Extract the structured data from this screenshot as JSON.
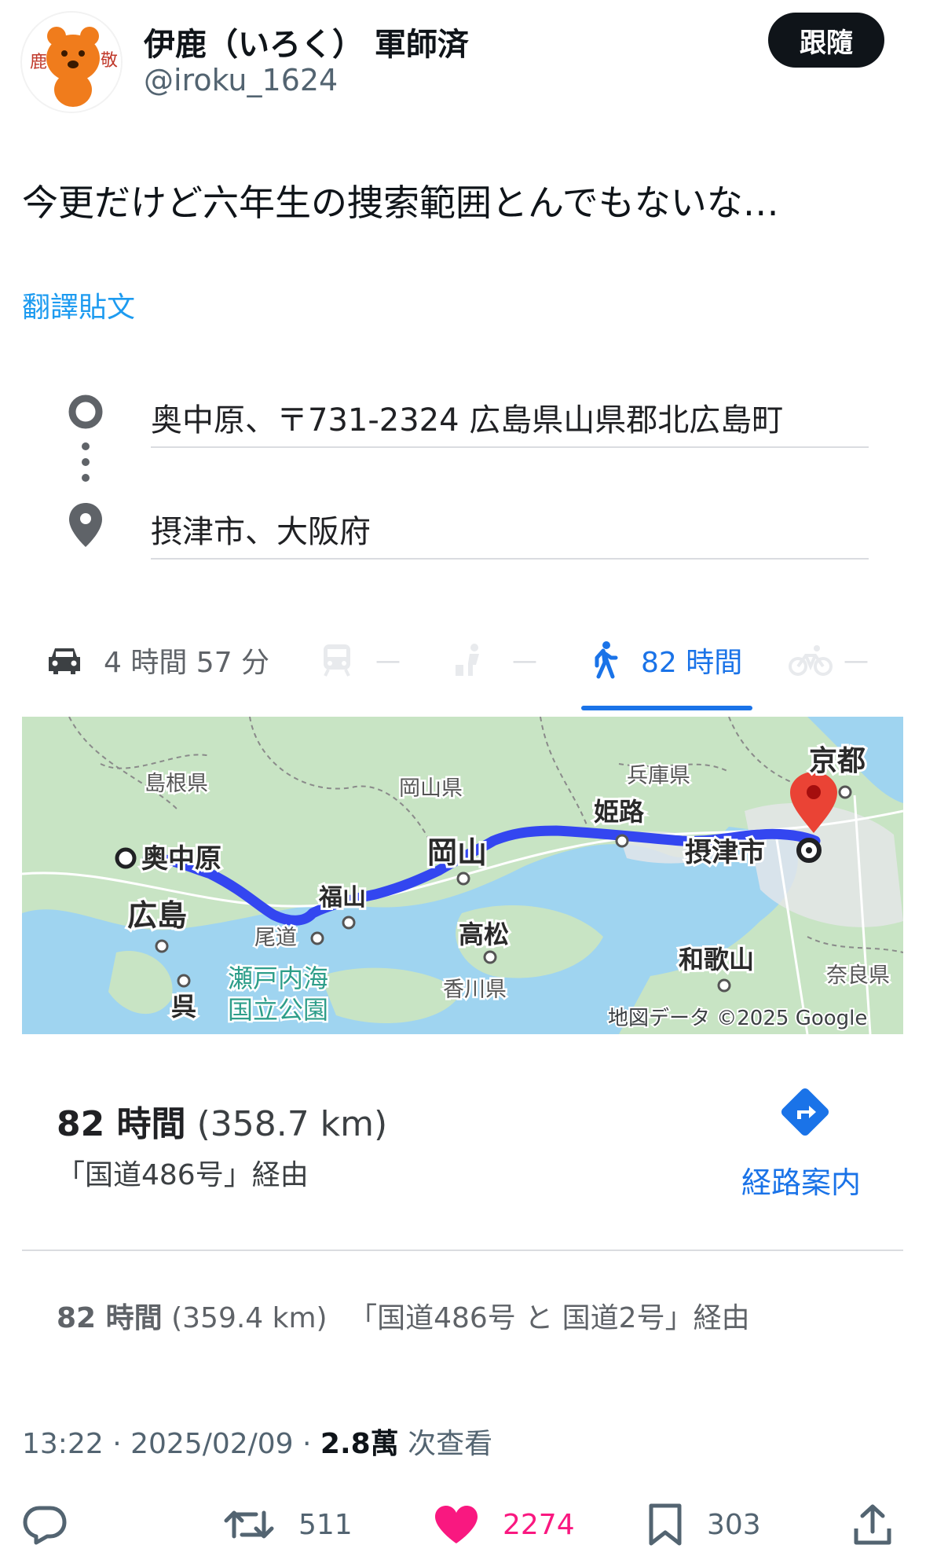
{
  "author": {
    "display_name": "伊鹿（いろく） 軍師済",
    "handle": "@iroku_1624",
    "follow_label": "跟隨"
  },
  "tweet": {
    "text": "今更だけど六年生の捜索範囲とんでもないな…",
    "translate_label": "翻譯貼文"
  },
  "directions": {
    "origin": "奥中原、〒731-2324 広島県山県郡北広島町",
    "destination": "摂津市、大阪府",
    "modes": {
      "drive": "4 時間 57 分",
      "transit": "—",
      "ride": "—",
      "walk": "82 時間",
      "bike": "—"
    },
    "map": {
      "labels": {
        "shimane": "島根県",
        "okayama_pref": "岡山県",
        "hyogo": "兵庫県",
        "kyoto": "京都",
        "okunakahara": "奥中原",
        "okayama": "岡山",
        "himeji": "姫路",
        "settsu": "摂津市",
        "hiroshima": "広島",
        "fukuyama": "福山",
        "onomichi": "尾道",
        "takamatsu": "高松",
        "kagawa": "香川県",
        "wakayama": "和歌山",
        "nara": "奈良県",
        "kure": "呉",
        "setonaikai_1": "瀬戸内海",
        "setonaikai_2": "国立公園",
        "attribution": "地図データ ©2025 Google"
      }
    },
    "summary": {
      "time": "82 時間",
      "distance": "(358.7 km)",
      "via": "「国道486号」経由",
      "nav_label": "経路案内"
    },
    "alternative": {
      "time": "82 時間",
      "distance": "(359.4 km)",
      "via": "「国道486号 と 国道2号」経由"
    }
  },
  "meta": {
    "time": "13:22 · 2025/02/09 · ",
    "views": "2.8萬",
    "views_label": " 次查看"
  },
  "actions": {
    "retweets": "511",
    "likes": "2274",
    "bookmarks": "303"
  },
  "colors": {
    "like": "#f91880",
    "link": "#1d9bf0",
    "maps_blue": "#1a73e8",
    "route": "#3346f0"
  }
}
